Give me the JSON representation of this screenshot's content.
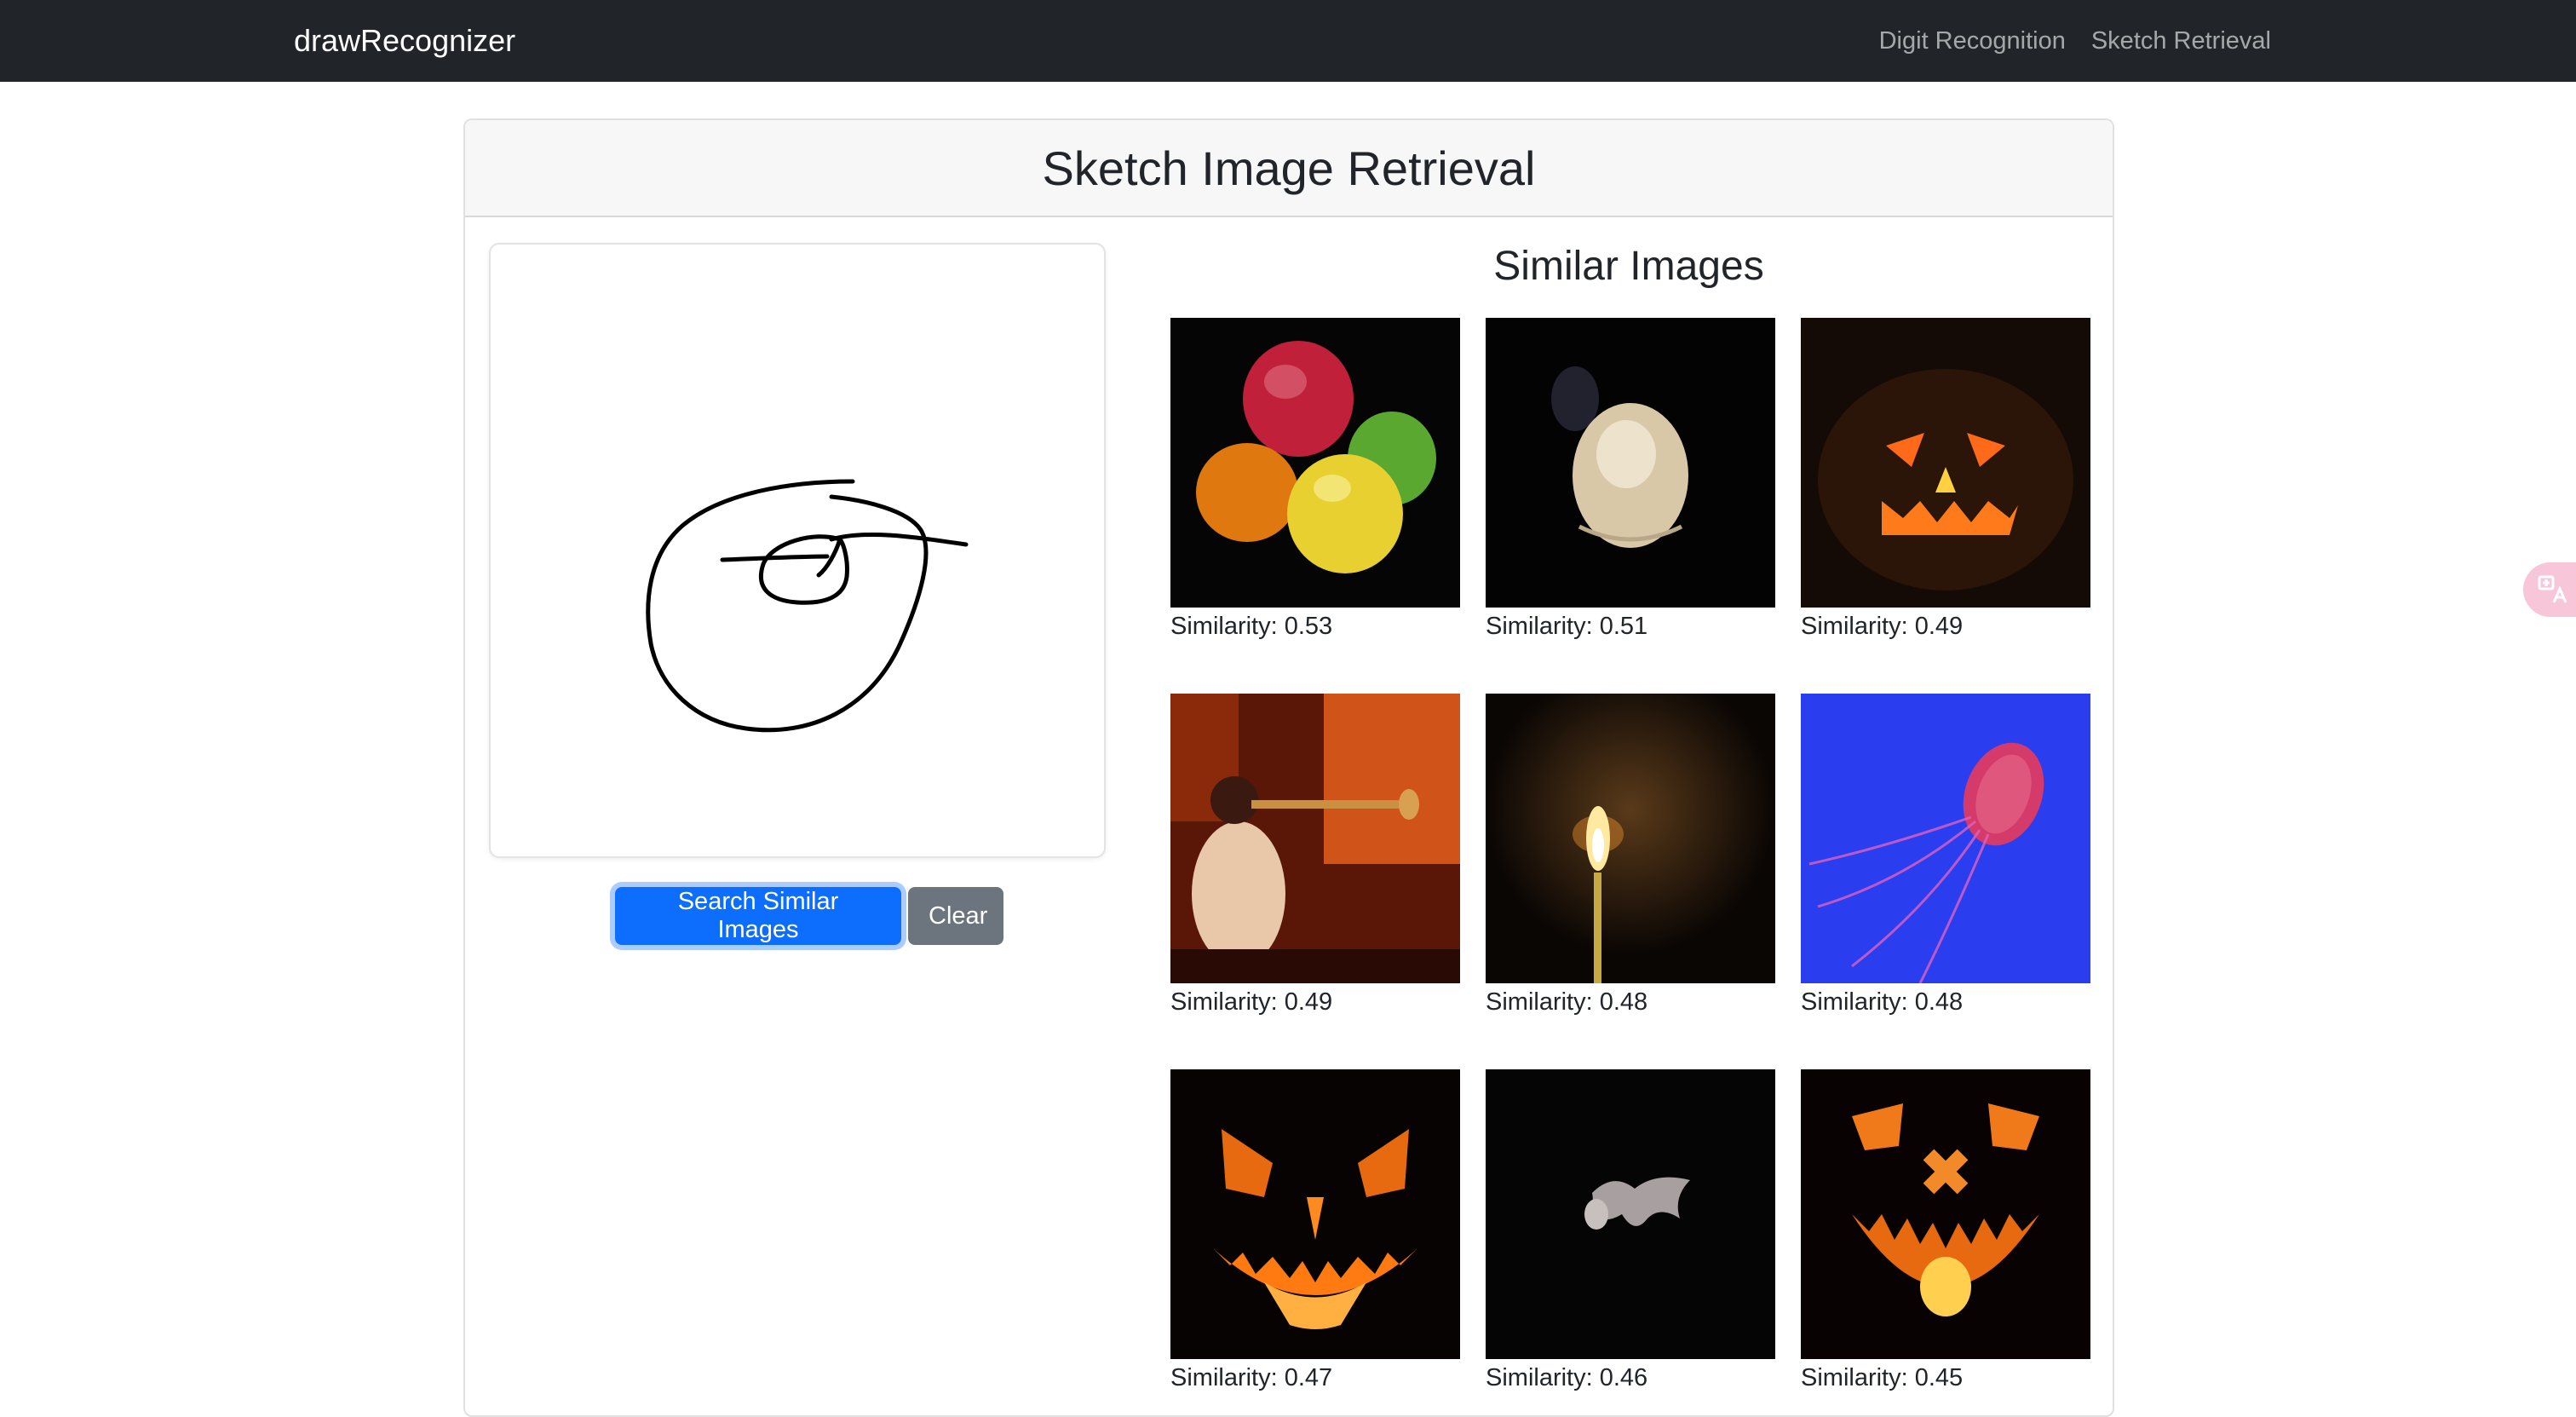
{
  "navbar": {
    "brand": "drawRecognizer",
    "links": [
      "Digit Recognition",
      "Sketch Retrieval"
    ]
  },
  "page": {
    "title": "Sketch Image Retrieval",
    "buttons": {
      "search": "Search Similar Images",
      "clear": "Clear"
    }
  },
  "results": {
    "title": "Similar Images",
    "items": [
      {
        "label": "Similarity: 0.53",
        "image": "fruits-apple-orange-lemon-lime"
      },
      {
        "label": "Similarity: 0.51",
        "image": "glowing-jellyfish-dark"
      },
      {
        "label": "Similarity: 0.49",
        "image": "jack-o-lantern-angry-face"
      },
      {
        "label": "Similarity: 0.49",
        "image": "trumpet-player-red-light"
      },
      {
        "label": "Similarity: 0.48",
        "image": "lit-candle-dark"
      },
      {
        "label": "Similarity: 0.48",
        "image": "jellyfish-blue-water"
      },
      {
        "label": "Similarity: 0.47",
        "image": "jack-o-lantern-fanged"
      },
      {
        "label": "Similarity: 0.46",
        "image": "bat-flying-dark"
      },
      {
        "label": "Similarity: 0.45",
        "image": "jack-o-lantern-x-face"
      }
    ]
  },
  "translate_button": {
    "icon": "translate-icon",
    "color": "#f7c6d8"
  },
  "colors": {
    "navbar": "#212529",
    "primary": "#0d6efd",
    "secondary": "#6c757d"
  }
}
